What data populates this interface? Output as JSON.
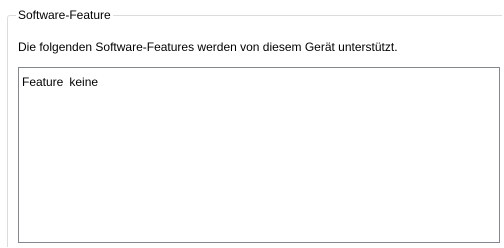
{
  "groupbox": {
    "title": "Software-Feature",
    "description": "Die folgenden Software-Features werden von diesem Gerät unterstützt."
  },
  "feature_list": {
    "items": [
      {
        "name": "Feature",
        "value": "keine"
      }
    ]
  }
}
